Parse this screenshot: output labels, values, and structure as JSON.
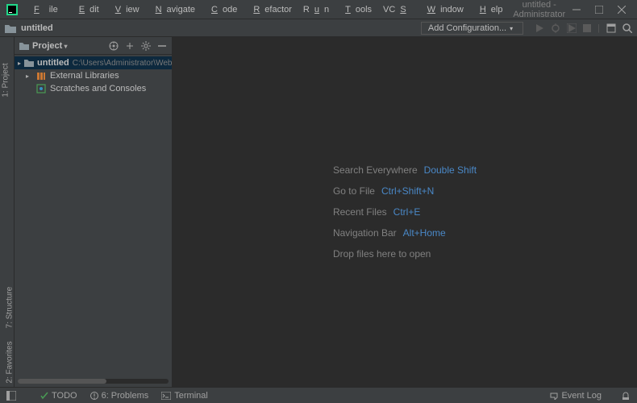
{
  "titlebar": {
    "menus": [
      "File",
      "Edit",
      "View",
      "Navigate",
      "Code",
      "Refactor",
      "Run",
      "Tools",
      "VCS",
      "Window",
      "Help"
    ],
    "title": "untitled - Administrator"
  },
  "navrow": {
    "breadcrumb": "untitled",
    "add_config": "Add Configuration..."
  },
  "leftstrip": {
    "project": "1: Project",
    "structure": "7: Structure",
    "favorites": "2: Favorites"
  },
  "project_panel": {
    "title": "Project",
    "tree": {
      "root": {
        "label": "untitled",
        "path": "C:\\Users\\Administrator\\WebstormProjects"
      },
      "ext_libs": "External Libraries",
      "scratches": "Scratches and Consoles"
    }
  },
  "hints": {
    "search": {
      "label": "Search Everywhere",
      "shortcut": "Double Shift"
    },
    "gotofile": {
      "label": "Go to File",
      "shortcut": "Ctrl+Shift+N"
    },
    "recent": {
      "label": "Recent Files",
      "shortcut": "Ctrl+E"
    },
    "navbar": {
      "label": "Navigation Bar",
      "shortcut": "Alt+Home"
    },
    "drop": {
      "label": "Drop files here to open"
    }
  },
  "bottombar": {
    "todo": "TODO",
    "problems": "6: Problems",
    "terminal": "Terminal",
    "eventlog": "Event Log"
  }
}
